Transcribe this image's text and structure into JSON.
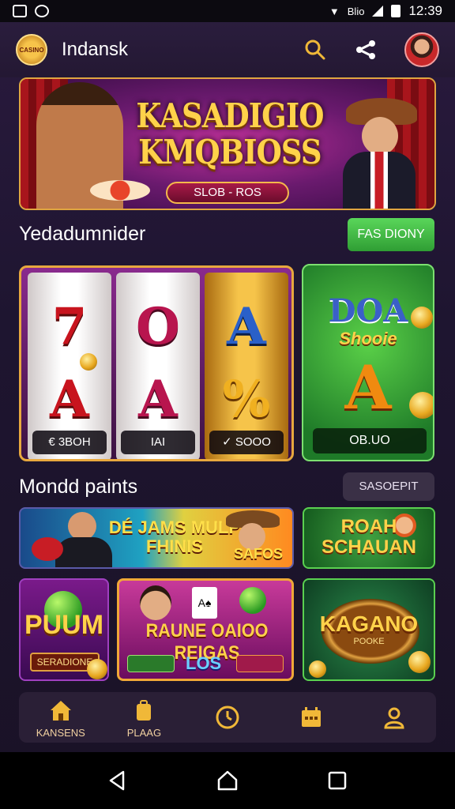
{
  "status_bar": {
    "time": "12:39",
    "network_label": "Blio"
  },
  "header": {
    "app_title": "Indansk",
    "logo_text": "CASINO",
    "icons": [
      "search-icon",
      "share-icon",
      "user-avatar"
    ]
  },
  "hero": {
    "title_line1": "KASADIGIO",
    "title_line2": "KMQBIOSS",
    "pill_text": "SLOB - ROS"
  },
  "section1": {
    "title": "Yedadumnider",
    "button_label": "FAS DIONY"
  },
  "slot_machine": {
    "reels": [
      {
        "top_symbol": "7",
        "bottom_symbol": "A",
        "label": "€ 3BOH"
      },
      {
        "top_symbol": "O",
        "bottom_symbol": "A",
        "label": "IAI"
      },
      {
        "top_symbol": "A",
        "bottom_symbol": "%",
        "label": "✓ SOOO"
      }
    ]
  },
  "feature_card": {
    "title": "DOA",
    "subtitle": "Shooie",
    "symbol": "A",
    "label": "OB.UO"
  },
  "section2": {
    "title": "Mondd paints",
    "button_label": "SASOEPIT"
  },
  "tiles": {
    "wide_title": "DÉ JAMS MULP FHINIS",
    "wide_small": "SAFOS",
    "roah_title": "ROAH SCHAUAN",
    "puum_title": "PUUM",
    "puum_sub": "SERADIONE",
    "mid_title": "RAUNE OAIOO REIGAS",
    "mid_logo": "LOS",
    "mid_card": "A♠",
    "kag_title": "KAGANO",
    "kag_sub": "POOKE"
  },
  "bottom_nav": {
    "items": [
      {
        "label": "KANSENS",
        "icon": "home-icon"
      },
      {
        "label": "PLAAG",
        "icon": "bag-icon"
      },
      {
        "label": "",
        "icon": "clock-icon"
      },
      {
        "label": "",
        "icon": "calendar-icon"
      },
      {
        "label": "",
        "icon": "profile-icon"
      }
    ]
  },
  "colors": {
    "accent_gold": "#f0b838",
    "accent_green": "#3fb43f",
    "background": "#1e1530"
  }
}
